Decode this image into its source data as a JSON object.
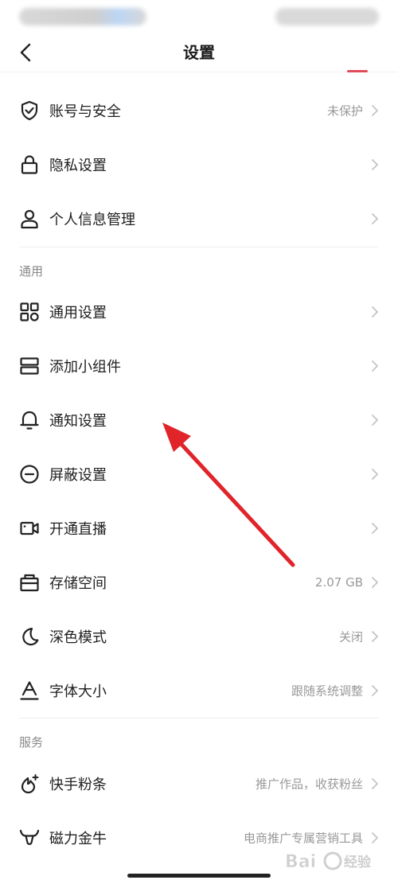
{
  "nav": {
    "title": "设置"
  },
  "items": {
    "account_security": {
      "label": "账号与安全",
      "value": "未保护"
    },
    "privacy": {
      "label": "隐私设置"
    },
    "personal_info": {
      "label": "个人信息管理"
    },
    "general_settings": {
      "label": "通用设置"
    },
    "add_widget": {
      "label": "添加小组件"
    },
    "notification": {
      "label": "通知设置"
    },
    "block": {
      "label": "屏蔽设置"
    },
    "live": {
      "label": "开通直播"
    },
    "storage": {
      "label": "存储空间",
      "value": "2.07 GB"
    },
    "dark_mode": {
      "label": "深色模式",
      "value": "关闭"
    },
    "font_size": {
      "label": "字体大小",
      "value": "跟随系统调整"
    },
    "kuaishou_boost": {
      "label": "快手粉条",
      "value": "推广作品，收获粉丝"
    },
    "magnetic_bull": {
      "label": "磁力金牛",
      "value": "电商推广专属营销工具"
    }
  },
  "sections": {
    "general": "通用",
    "services": "服务"
  },
  "watermark": {
    "text": "Bai 经验"
  },
  "colors": {
    "annotation_arrow": "#e0242a",
    "chevron": "#c4c4c4",
    "icon": "#222222"
  }
}
